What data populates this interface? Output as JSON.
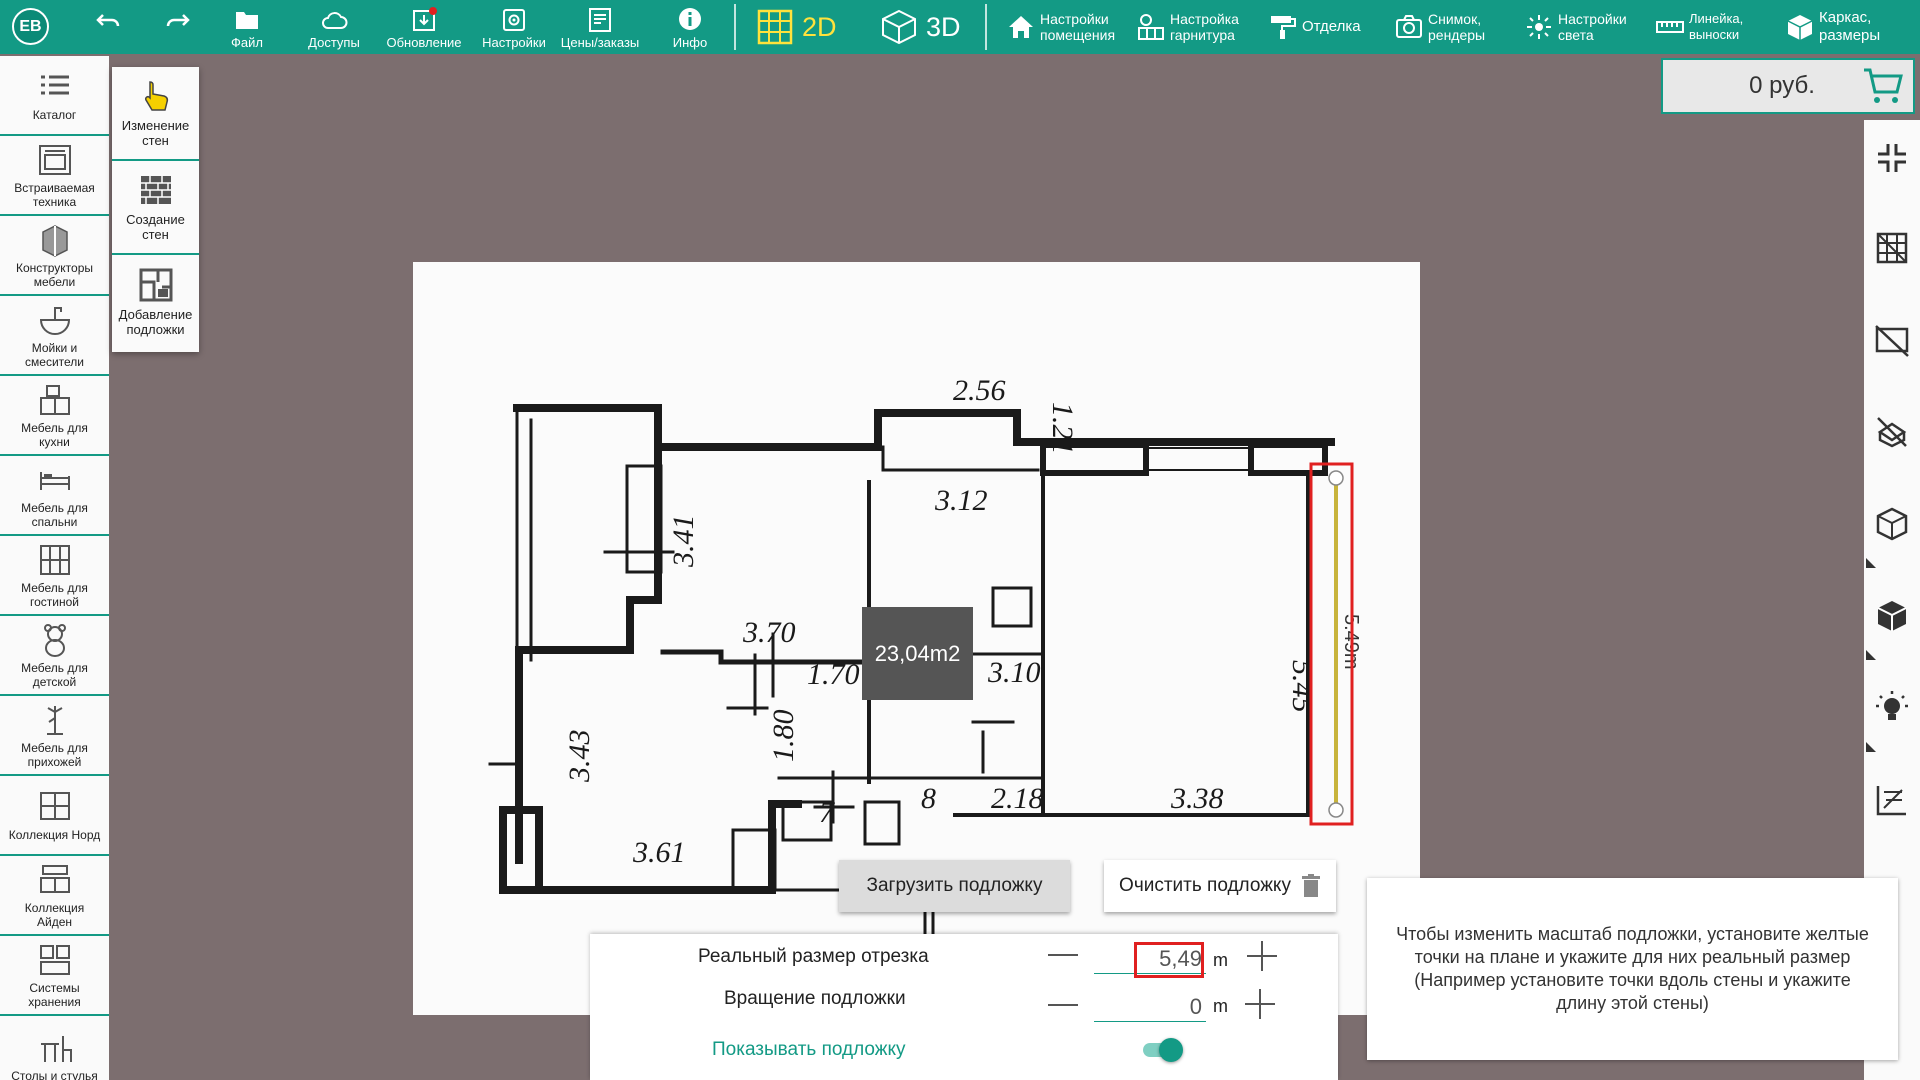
{
  "user": {
    "initials": "ЕВ"
  },
  "toolbar": {
    "file": "Файл",
    "access": "Доступы",
    "update": "Обновление",
    "settings": "Настройки",
    "prices": "Цены/заказы",
    "info": "Инфо",
    "mode2d": "2D",
    "mode3d": "3D",
    "room_settings_1": "Настройки",
    "room_settings_2": "помещения",
    "set_settings_1": "Настройка",
    "set_settings_2": "гарнитура",
    "finish": "Отделка",
    "snapshot_1": "Снимок,",
    "snapshot_2": "рендеры",
    "light_1": "Настройки",
    "light_2": "света",
    "ruler_1": "Линейка,",
    "ruler_2": "выноски",
    "frame_1": "Каркас,",
    "frame_2": "размеры"
  },
  "price": {
    "value": "0 руб."
  },
  "sidebar": {
    "items": [
      {
        "l1": "Каталог",
        "l2": ""
      },
      {
        "l1": "Встраиваемая",
        "l2": "техника"
      },
      {
        "l1": "Конструкторы",
        "l2": "мебели"
      },
      {
        "l1": "Мойки и",
        "l2": "смесители"
      },
      {
        "l1": "Мебель для",
        "l2": "кухни"
      },
      {
        "l1": "Мебель для",
        "l2": "спальни"
      },
      {
        "l1": "Мебель для",
        "l2": "гостиной"
      },
      {
        "l1": "Мебель для",
        "l2": "детской"
      },
      {
        "l1": "Мебель для",
        "l2": "прихожей"
      },
      {
        "l1": "Коллекция Норд",
        "l2": ""
      },
      {
        "l1": "Коллекция",
        "l2": "Айден"
      },
      {
        "l1": "Системы",
        "l2": "хранения"
      },
      {
        "l1": "Столы и стулья",
        "l2": ""
      }
    ]
  },
  "tools": {
    "edit_walls_1": "Изменение",
    "edit_walls_2": "стен",
    "create_walls_1": "Создание",
    "create_walls_2": "стен",
    "add_underlay_1": "Добавление",
    "add_underlay_2": "подложки"
  },
  "plan": {
    "area": "23,04m2",
    "dims": [
      "2.56",
      "1.21",
      "3.12",
      "3.41",
      "3.70",
      "1.70",
      "3.10",
      "5.45",
      "1.80",
      "3.43",
      "3.61",
      "7",
      "8",
      "2.18",
      "3.38"
    ],
    "segment_label": "5.49m"
  },
  "buttons": {
    "load_underlay": "Загрузить подложку",
    "clear_underlay": "Очистить подложку"
  },
  "panel": {
    "real_size_label": "Реальный размер отрезка",
    "real_size_value": "5,49",
    "rotation_label": "Вращение подложки",
    "rotation_value": "0",
    "unit": "m",
    "show_underlay": "Показывать подложку",
    "show_underlay_on": true
  },
  "hint": {
    "text": "Чтобы изменить масштаб подложки, установите желтые точки на плане и укажите для них реальный размер (Например установите точки вдоль стены и укажите длину этой стены)"
  },
  "colors": {
    "accent": "#139a85",
    "background": "#7c6e6f",
    "highlight": "#e02020",
    "segment": "#c8b43c"
  }
}
